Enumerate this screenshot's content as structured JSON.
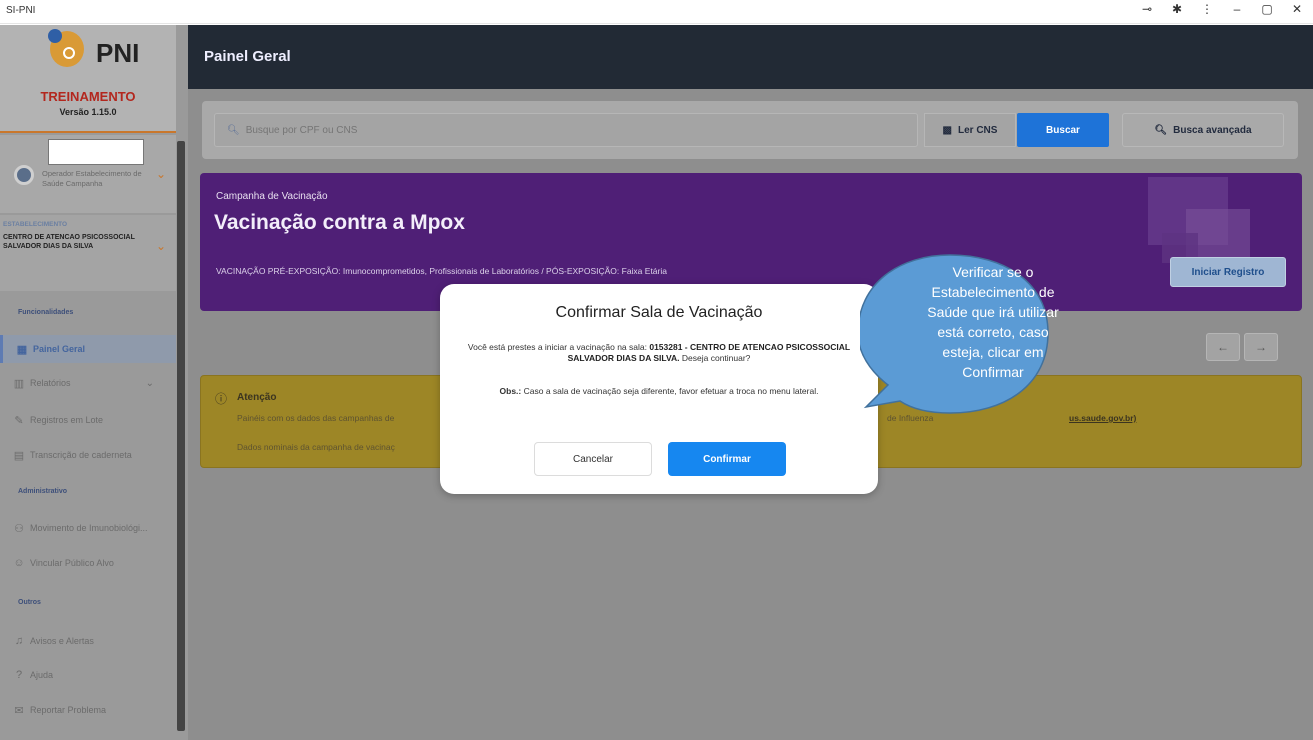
{
  "window": {
    "title": "SI-PNI"
  },
  "sidebar": {
    "logo_text": "PNI",
    "environment": "TREINAMENTO",
    "version": "Versão 1.15.0",
    "user": {
      "role": "Operador Estabelecimento de Saúde Campanha"
    },
    "establishment": {
      "label": "ESTABELECIMENTO",
      "name": "CENTRO DE ATENCAO PSICOSSOCIAL SALVADOR DIAS DA SILVA"
    },
    "sections": {
      "funcionalidades": "Funcionalidades",
      "administrativo": "Administrativo",
      "outros": "Outros"
    },
    "items": [
      {
        "label": "Painel Geral",
        "icon": "dashboard-icon"
      },
      {
        "label": "Relatórios",
        "icon": "chart-icon"
      },
      {
        "label": "Registros em Lote",
        "icon": "pencil-icon"
      },
      {
        "label": "Transcrição de caderneta",
        "icon": "document-icon"
      },
      {
        "label": "Movimento de Imunobiológi...",
        "icon": "users-icon"
      },
      {
        "label": "Vincular Público Alvo",
        "icon": "user-icon"
      },
      {
        "label": "Avisos e Alertas",
        "icon": "bell-icon"
      },
      {
        "label": "Ajuda",
        "icon": "help-icon"
      },
      {
        "label": "Reportar Problema",
        "icon": "chat-icon"
      }
    ]
  },
  "header": {
    "title": "Painel Geral"
  },
  "search": {
    "placeholder": "Busque por CPF ou CNS",
    "ler_cns": "Ler CNS",
    "buscar": "Buscar",
    "busca_avancada": "Busca avançada"
  },
  "campaign": {
    "subtitle": "Campanha de Vacinação",
    "title": "Vacinação contra a Mpox",
    "description": "VACINAÇÃO PRÉ-EXPOSIÇÃO: Imunocomprometidos, Profissionais de Laboratórios / PÓS-EXPOSIÇÃO: Faixa Etária",
    "button": "Iniciar Registro"
  },
  "alert": {
    "title": "Atenção",
    "line1": "Painéis com os dados das campanhas de",
    "line1_right": "de Influenza",
    "link": "us.saude.gov.br)",
    "line2": "Dados nominais da campanha de vacinaç"
  },
  "modal": {
    "title": "Confirmar Sala de Vacinação",
    "body_prefix": "Você está prestes a iniciar a vacinação na sala:",
    "room": "0153281 - CENTRO DE ATENCAO PSICOSSOCIAL SALVADOR DIAS DA SILVA.",
    "body_suffix": "Deseja continuar?",
    "obs_label": "Obs.:",
    "obs": "Caso a sala de vacinação seja diferente, favor efetuar a troca no menu lateral.",
    "cancel": "Cancelar",
    "confirm": "Confirmar"
  },
  "callout": {
    "text": "Verificar se o Estabelecimento de Saúde que irá utilizar está correto, caso esteja, clicar em Confirmar"
  },
  "colors": {
    "campaign": "#4f1f76",
    "primary": "#1687f0",
    "header": "#222a35",
    "callout": "#5b9bd5"
  }
}
